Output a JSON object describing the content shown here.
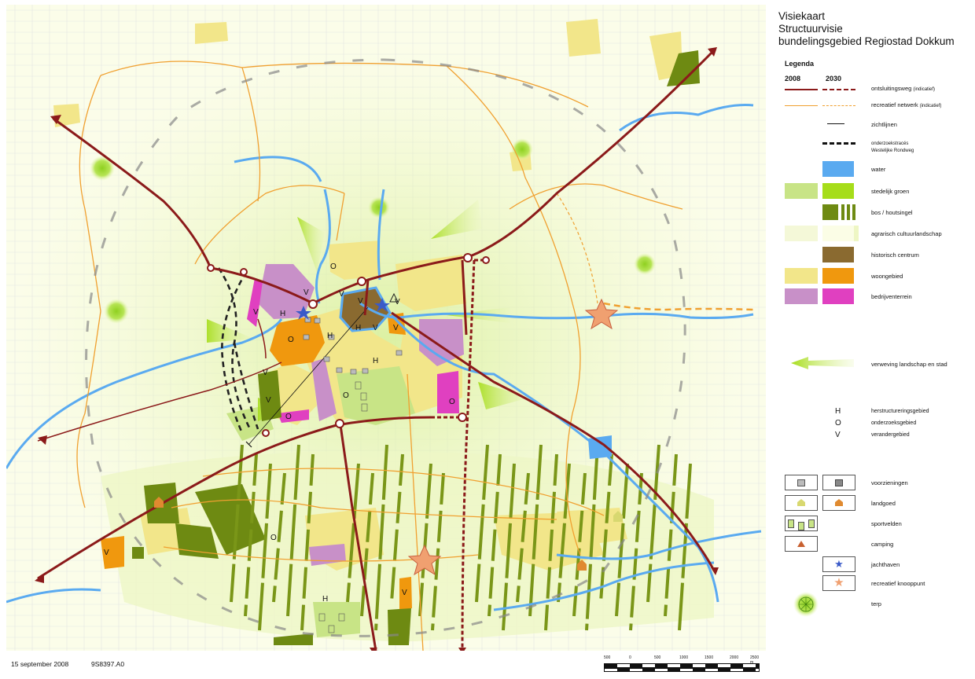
{
  "title": {
    "line1": "Visiekaart",
    "line2": "Structuurvisie",
    "line3": "bundelingsgebied Regiostad Dokkum"
  },
  "legend": {
    "heading": "Legenda",
    "col_2008": "2008",
    "col_2030": "2030",
    "items": [
      {
        "label": "ontsluitingsweg",
        "note": "(indicatief)"
      },
      {
        "label": "recreatief netwerk",
        "note": "(indicatief)"
      },
      {
        "label": "zichtlijnen",
        "note": ""
      },
      {
        "label": "onderzoekstracés",
        "note": "Westelijke Rondweg"
      },
      {
        "label": "water",
        "note": ""
      },
      {
        "label": "stedelijk groen",
        "note": ""
      },
      {
        "label": "bos / houtsingel",
        "note": ""
      },
      {
        "label": "agrarisch cultuurlandschap",
        "note": ""
      },
      {
        "label": "historisch centrum",
        "note": ""
      },
      {
        "label": "woongebied",
        "note": ""
      },
      {
        "label": "bedrijventerrein",
        "note": ""
      },
      {
        "label": "verweving landschap en stad",
        "note": ""
      }
    ],
    "letters": {
      "H": "H",
      "O": "O",
      "V": "V",
      "h_label": "herstructureringsgebied",
      "o_label": "onderzoeksgebied",
      "v_label": "verandergebied"
    },
    "symbols": [
      {
        "label": "voorzieningen"
      },
      {
        "label": "landgoed"
      },
      {
        "label": "sportvelden"
      },
      {
        "label": "camping"
      },
      {
        "label": "jachthaven"
      },
      {
        "label": "recreatief knooppunt"
      },
      {
        "label": "terp"
      }
    ]
  },
  "colors": {
    "road": "#8b1a1a",
    "recreational": "#f0a030",
    "water": "#5aaaf0",
    "urban_green_2008": "#c8e486",
    "urban_green_2030": "#a6dd1a",
    "forest": "#6e8a12",
    "agri_2008": "#f4f8d8",
    "agri_2030": "#fbfde6",
    "historic": "#8a6a30",
    "housing_2008": "#f2e68a",
    "housing_2030": "#f0980e",
    "industry_2008": "#c890c8",
    "industry_2030": "#e040c0",
    "interweaving": "#c6e96c"
  },
  "map_labels": {
    "H": "H",
    "O": "O",
    "V": "V"
  },
  "footer": {
    "date": "15 september 2008",
    "code": "9S8397.A0",
    "scale_ticks": [
      "500",
      "0",
      "500",
      "1000",
      "1500",
      "2000",
      "2500 m"
    ]
  }
}
